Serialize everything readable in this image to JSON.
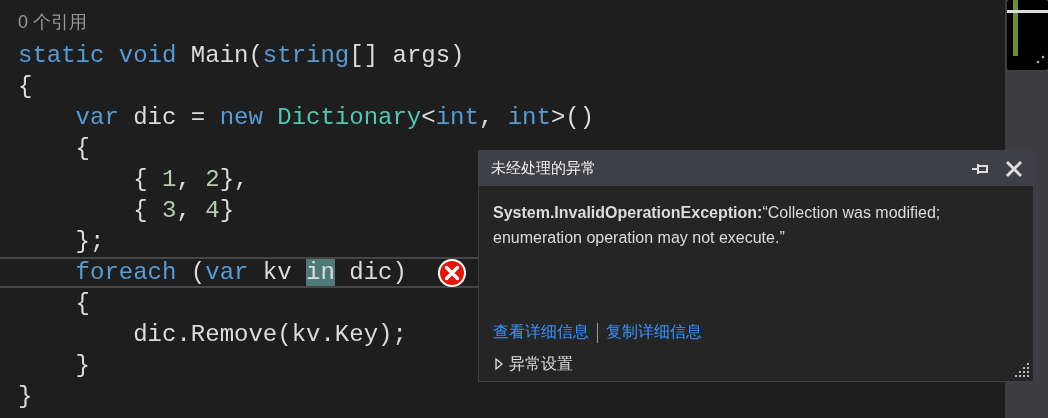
{
  "codelens": "0 个引用",
  "lines": [
    {
      "current": false,
      "error": false,
      "tokens": [
        {
          "kind": "keyword",
          "text": "static void "
        },
        {
          "kind": "plain",
          "text": "Main("
        },
        {
          "kind": "keyword",
          "text": "string"
        },
        {
          "kind": "plain",
          "text": "[] args)"
        }
      ]
    },
    {
      "current": false,
      "error": false,
      "tokens": [
        {
          "kind": "plain",
          "text": "{"
        }
      ]
    },
    {
      "current": false,
      "error": false,
      "tokens": [
        {
          "kind": "keyword",
          "text": "    var "
        },
        {
          "kind": "plain",
          "text": "dic = "
        },
        {
          "kind": "keyword",
          "text": "new "
        },
        {
          "kind": "type",
          "text": "Dictionary"
        },
        {
          "kind": "plain",
          "text": "<"
        },
        {
          "kind": "keyword",
          "text": "int"
        },
        {
          "kind": "plain",
          "text": ", "
        },
        {
          "kind": "keyword",
          "text": "int"
        },
        {
          "kind": "plain",
          "text": ">()"
        }
      ]
    },
    {
      "current": false,
      "error": false,
      "tokens": [
        {
          "kind": "plain",
          "text": "    {"
        }
      ]
    },
    {
      "current": false,
      "error": false,
      "tokens": [
        {
          "kind": "plain",
          "text": "        { "
        },
        {
          "kind": "number",
          "text": "1"
        },
        {
          "kind": "plain",
          "text": ", "
        },
        {
          "kind": "number",
          "text": "2"
        },
        {
          "kind": "plain",
          "text": "},"
        }
      ]
    },
    {
      "current": false,
      "error": false,
      "tokens": [
        {
          "kind": "plain",
          "text": "        { "
        },
        {
          "kind": "number",
          "text": "3"
        },
        {
          "kind": "plain",
          "text": ", "
        },
        {
          "kind": "number",
          "text": "4"
        },
        {
          "kind": "plain",
          "text": "}"
        }
      ]
    },
    {
      "current": false,
      "error": false,
      "tokens": [
        {
          "kind": "plain",
          "text": "    };"
        }
      ]
    },
    {
      "current": true,
      "error": true,
      "tokens": [
        {
          "kind": "keyword",
          "text": "    foreach "
        },
        {
          "kind": "plain",
          "text": "("
        },
        {
          "kind": "keyword",
          "text": "var "
        },
        {
          "kind": "plain",
          "text": "kv "
        },
        {
          "kind": "match",
          "text": "in"
        },
        {
          "kind": "plain",
          "text": " dic)"
        }
      ]
    },
    {
      "current": false,
      "error": false,
      "tokens": [
        {
          "kind": "plain",
          "text": "    {"
        }
      ]
    },
    {
      "current": false,
      "error": false,
      "tokens": [
        {
          "kind": "plain",
          "text": "        dic.Remove(kv.Key);"
        }
      ]
    },
    {
      "current": false,
      "error": false,
      "tokens": [
        {
          "kind": "plain",
          "text": "    }"
        }
      ]
    },
    {
      "current": false,
      "error": false,
      "tokens": [
        {
          "kind": "plain",
          "text": "}"
        }
      ]
    }
  ],
  "popup": {
    "title": "未经处理的异常",
    "message": "**System.InvalidOperationException:**“Collection was modified; enumeration operation may not execute.”",
    "links": [
      "查看详细信息",
      "复制详细信息"
    ],
    "settings": {
      "label": "异常设置",
      "expanded": false
    }
  }
}
